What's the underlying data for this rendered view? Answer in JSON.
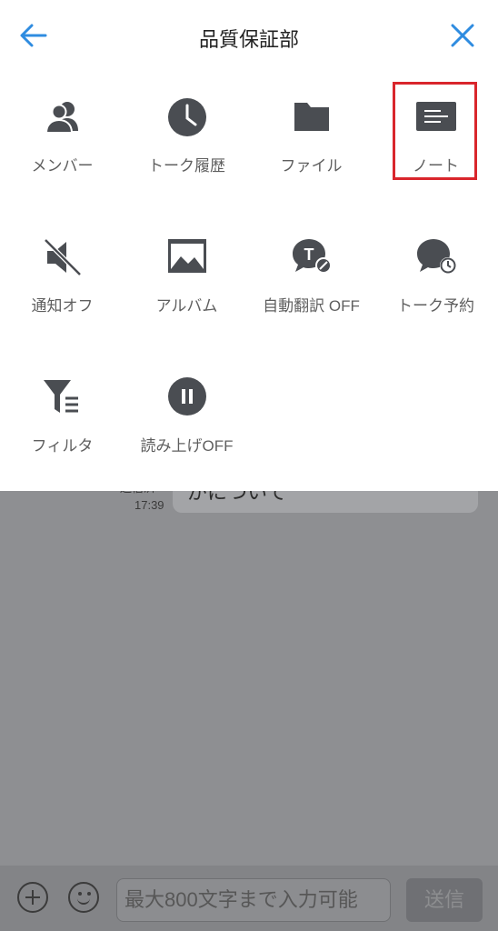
{
  "header": {
    "title": "品質保証部"
  },
  "menu": [
    {
      "label": "メンバー",
      "icon": "members-icon"
    },
    {
      "label": "トーク履歴",
      "icon": "clock-icon"
    },
    {
      "label": "ファイル",
      "icon": "folder-icon"
    },
    {
      "label": "ノート",
      "icon": "note-icon"
    },
    {
      "label": "通知オフ",
      "icon": "mute-icon"
    },
    {
      "label": "アルバム",
      "icon": "album-icon"
    },
    {
      "label": "自動翻訳 OFF",
      "icon": "translate-icon"
    },
    {
      "label": "トーク予約",
      "icon": "scheduled-talk-icon"
    },
    {
      "label": "フィルタ",
      "icon": "filter-icon"
    },
    {
      "label": "読み上げOFF",
      "icon": "pause-icon"
    }
  ],
  "chat": {
    "message_text": "がについて",
    "read_label": "送信済",
    "time": "17:39"
  },
  "input": {
    "placeholder": "最大800文字まで入力可能",
    "send_label": "送信"
  },
  "colors": {
    "accent": "#2f8ce0",
    "highlight": "#d9262c",
    "icon": "#4a4d52"
  }
}
